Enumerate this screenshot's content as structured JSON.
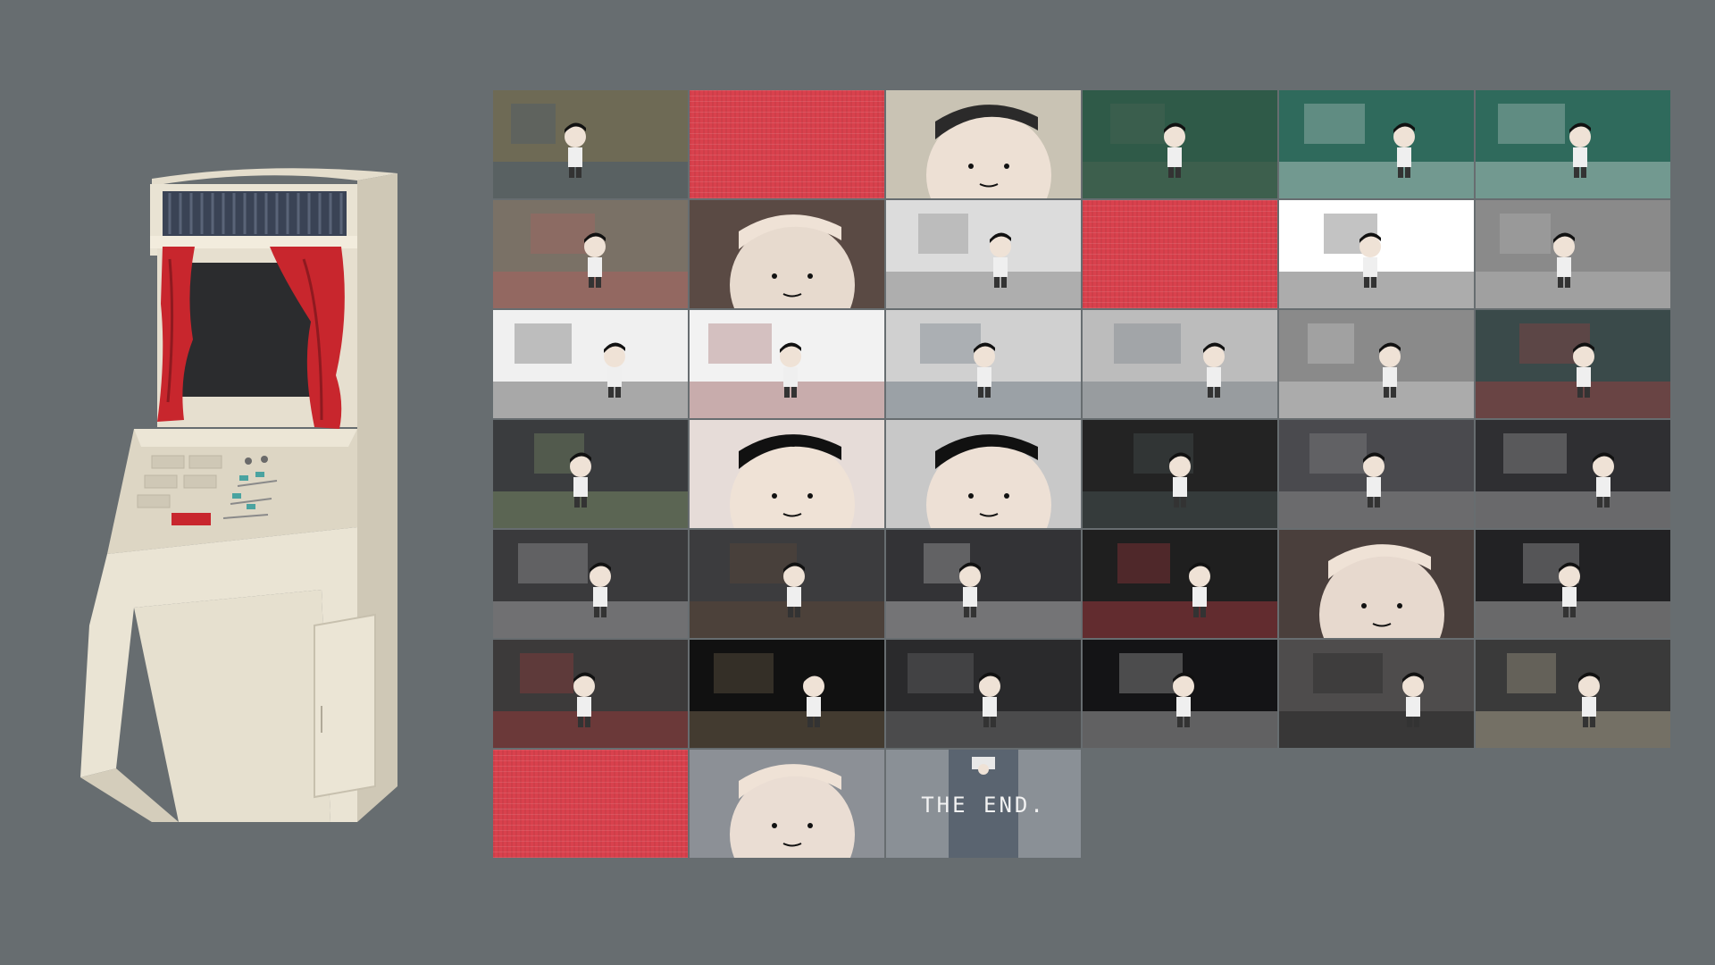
{
  "cabinet": {
    "body_color": "#ece6d6",
    "curtain_color": "#c8262d",
    "screen_color": "#2b2c2e",
    "marquee_color": "#3a4355"
  },
  "storyboard": {
    "frames": [
      {
        "id": 1,
        "scene": "cluttered-room",
        "style": "scene",
        "palette": [
          "#6e6a55",
          "#34507a"
        ]
      },
      {
        "id": 2,
        "scene": "red-static",
        "style": "red"
      },
      {
        "id": 3,
        "scene": "sleeping-face-closeup",
        "style": "face",
        "palette": [
          "#c9c3b4",
          "#2b2a2a"
        ]
      },
      {
        "id": 4,
        "scene": "hand-on-green-table",
        "style": "scene",
        "palette": [
          "#2f5a48",
          "#5a6a5a"
        ]
      },
      {
        "id": 5,
        "scene": "boy-walking-window",
        "style": "scene",
        "palette": [
          "#2f6a5c",
          "#f2f2f2"
        ]
      },
      {
        "id": 6,
        "scene": "boy-at-window-back",
        "style": "scene",
        "palette": [
          "#2f6a5c",
          "#f2f2f2"
        ]
      },
      {
        "id": 7,
        "scene": "girl-on-stairs-hearts",
        "style": "scene",
        "palette": [
          "#7a7166",
          "#c25a5a"
        ]
      },
      {
        "id": 8,
        "scene": "boy-portrait-blush",
        "style": "face",
        "palette": [
          "#5a4a44",
          "#efe2d6"
        ]
      },
      {
        "id": 9,
        "scene": "stairs-with-letter",
        "style": "scene",
        "palette": [
          "#dcdcdc",
          "#5a5a5a"
        ]
      },
      {
        "id": 10,
        "scene": "red-static",
        "style": "red"
      },
      {
        "id": 11,
        "scene": "silhouette-with-frame",
        "style": "scene",
        "palette": [
          "#ffffff",
          "#111111"
        ]
      },
      {
        "id": 12,
        "scene": "hospital-bed",
        "style": "scene",
        "palette": [
          "#8a8a8a",
          "#c8c8c8"
        ]
      },
      {
        "id": 13,
        "scene": "doctor-and-bandaged-boy",
        "style": "scene",
        "palette": [
          "#f0f0f0",
          "#222222"
        ]
      },
      {
        "id": 14,
        "scene": "boy-at-vending-machine",
        "style": "scene",
        "palette": [
          "#f2f2f2",
          "#7a2a2a"
        ]
      },
      {
        "id": 15,
        "scene": "old-man-and-boy",
        "style": "scene",
        "palette": [
          "#d0d0d0",
          "#3a4a5a"
        ]
      },
      {
        "id": 16,
        "scene": "grandpa-on-sofa",
        "style": "scene",
        "palette": [
          "#bcbcbc",
          "#55606a"
        ]
      },
      {
        "id": 17,
        "scene": "hospital-bed-glow",
        "style": "scene",
        "palette": [
          "#8a8a8a",
          "#e8e8e8"
        ]
      },
      {
        "id": 18,
        "scene": "boy-toys-dream",
        "style": "scene",
        "palette": [
          "#3a4a4a",
          "#c23a3a"
        ]
      },
      {
        "id": 19,
        "scene": "frog-hat-boy",
        "style": "scene",
        "palette": [
          "#3a3c3e",
          "#9ab27a"
        ]
      },
      {
        "id": 20,
        "scene": "closed-eyes-face",
        "style": "face",
        "palette": [
          "#e6dcd8",
          "#111111"
        ]
      },
      {
        "id": 21,
        "scene": "bandaged-boy-profile",
        "style": "face",
        "palette": [
          "#c8c8c8",
          "#111111"
        ]
      },
      {
        "id": 22,
        "scene": "pile-of-toys",
        "style": "scene",
        "palette": [
          "#232323",
          "#5a6a6a"
        ]
      },
      {
        "id": 23,
        "scene": "boy-on-bed-dark",
        "style": "scene",
        "palette": [
          "#4a4a4e",
          "#a8a8a8"
        ]
      },
      {
        "id": 24,
        "scene": "boy-floating-light",
        "style": "scene",
        "palette": [
          "#2f2f32",
          "#d8d8d8"
        ]
      },
      {
        "id": 25,
        "scene": "boy-sitting-spotlight",
        "style": "scene",
        "palette": [
          "#3a3a3c",
          "#d8d8d8"
        ]
      },
      {
        "id": 26,
        "scene": "shoes-from-above",
        "style": "scene",
        "palette": [
          "#3c3c3e",
          "#6a4a34"
        ]
      },
      {
        "id": 27,
        "scene": "boy-standing-dark",
        "style": "scene",
        "palette": [
          "#333336",
          "#efefef"
        ]
      },
      {
        "id": 28,
        "scene": "red-door-dark",
        "style": "scene",
        "palette": [
          "#1f1f1f",
          "#e0444c"
        ]
      },
      {
        "id": 29,
        "scene": "worried-boy-closeup",
        "style": "face",
        "palette": [
          "#4a3f3c",
          "#efe2d6"
        ]
      },
      {
        "id": 30,
        "scene": "boy-in-dark-hallway",
        "style": "scene",
        "palette": [
          "#222224",
          "#efefef"
        ]
      },
      {
        "id": 31,
        "scene": "portraits-on-wall",
        "style": "scene",
        "palette": [
          "#3c3a3a",
          "#c23a3a"
        ]
      },
      {
        "id": 32,
        "scene": "boy-in-spotlight-cone",
        "style": "scene",
        "palette": [
          "#111111",
          "#a08a6a"
        ]
      },
      {
        "id": 33,
        "scene": "corridor-far-figure",
        "style": "scene",
        "palette": [
          "#2a2a2c",
          "#8a8a8a"
        ]
      },
      {
        "id": 34,
        "scene": "glowing-figure-corridor",
        "style": "scene",
        "palette": [
          "#141416",
          "#f2f2f2"
        ]
      },
      {
        "id": 35,
        "scene": "black-streak-wall",
        "style": "scene",
        "palette": [
          "#4e4c4c",
          "#111111"
        ]
      },
      {
        "id": 36,
        "scene": "boy-and-girl-portrait",
        "style": "scene",
        "palette": [
          "#3a3a3a",
          "#e2d8b8"
        ]
      },
      {
        "id": 37,
        "scene": "red-static",
        "style": "red"
      },
      {
        "id": 38,
        "scene": "bandaged-boy-face",
        "style": "face",
        "palette": [
          "#8c9096",
          "#efe2d6"
        ]
      },
      {
        "id": 39,
        "scene": "the-end-bed",
        "style": "end",
        "palette": [
          "#8a9096",
          "#5a6470"
        ],
        "caption": "THE END."
      }
    ]
  }
}
